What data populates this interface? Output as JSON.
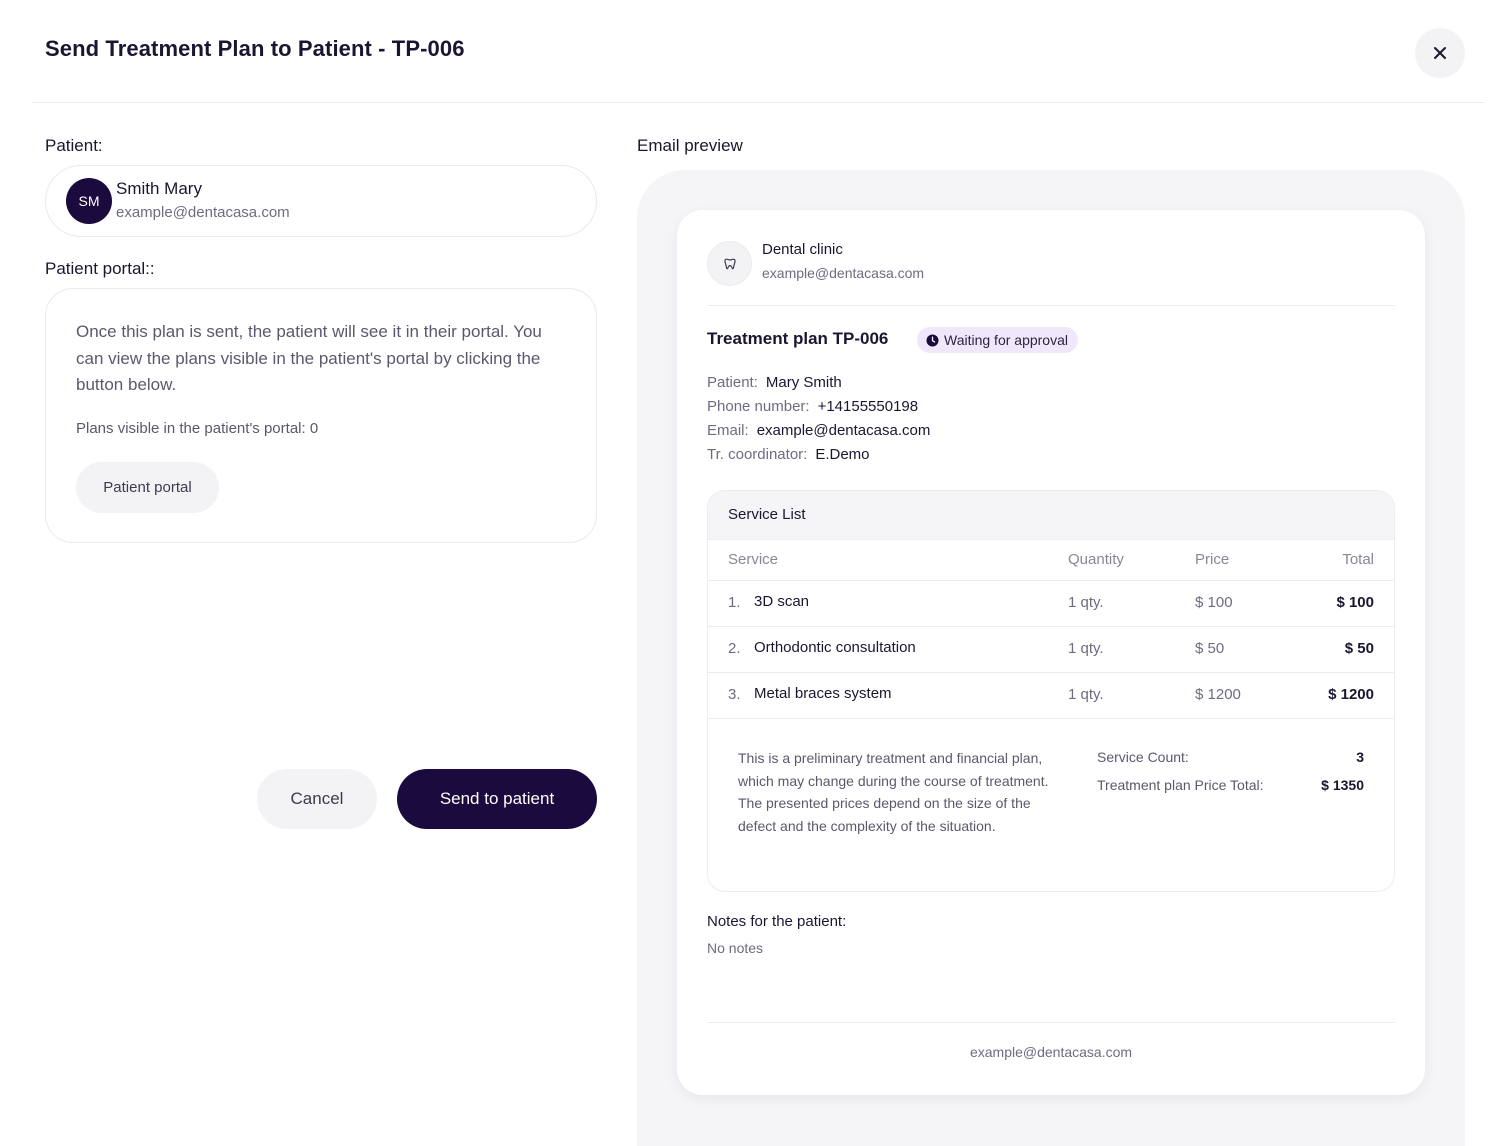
{
  "dialog": {
    "title": "Send Treatment Plan to Patient - TP-006",
    "close_icon": "close-icon"
  },
  "patient": {
    "label": "Patient:",
    "initials": "SM",
    "name": "Smith Mary",
    "email": "example@dentacasa.com"
  },
  "portal": {
    "label": "Patient portal::",
    "text": "Once this plan is sent, the patient will see it in their portal. You can view the plans visible in the patient's portal by clicking the button below.",
    "visible_count": "Plans visible in the patient's portal: 0",
    "button": "Patient portal"
  },
  "actions": {
    "cancel": "Cancel",
    "send": "Send to patient"
  },
  "preview": {
    "label": "Email preview",
    "clinic": {
      "icon": "tooth-icon",
      "name": "Dental clinic",
      "email": "example@dentacasa.com"
    },
    "plan_title": "Treatment plan TP-006",
    "status": {
      "icon": "clock-icon",
      "label": "Waiting for approval",
      "color": "#efe8fb"
    },
    "info": [
      {
        "key": "Patient:",
        "value": "Mary Smith"
      },
      {
        "key": "Phone number:",
        "value": "+14155550198"
      },
      {
        "key": "Email:",
        "value": "example@dentacasa.com"
      },
      {
        "key": "Tr. coordinator:",
        "value": "E.Demo"
      }
    ],
    "service_list": {
      "title": "Service List",
      "columns": [
        "Service",
        "Quantity",
        "Price",
        "Total"
      ],
      "rows": [
        {
          "num": "1.",
          "name": "3D scan",
          "qty": "1 qty.",
          "price": "$ 100",
          "total": "$ 100"
        },
        {
          "num": "2.",
          "name": "Orthodontic consultation",
          "qty": "1 qty.",
          "price": "$ 50",
          "total": "$ 50"
        },
        {
          "num": "3.",
          "name": "Metal braces system",
          "qty": "1 qty.",
          "price": "$ 1200",
          "total": "$ 1200"
        }
      ],
      "disclaimer": "This is a preliminary treatment and financial plan, which may change during the course of treatment. The presented prices depend on the size of the defect and the complexity of the situation.",
      "summary": {
        "count_label": "Service Count:",
        "count_value": "3",
        "total_label": "Treatment plan Price Total:",
        "total_value": "$ 1350"
      }
    },
    "notes_label": "Notes for the patient:",
    "notes_value": "No notes",
    "footer_email": "example@dentacasa.com"
  },
  "colors": {
    "primary": "#1b0a3d",
    "badge_bg": "#efe8fb",
    "panel_bg": "#f5f5f8"
  }
}
